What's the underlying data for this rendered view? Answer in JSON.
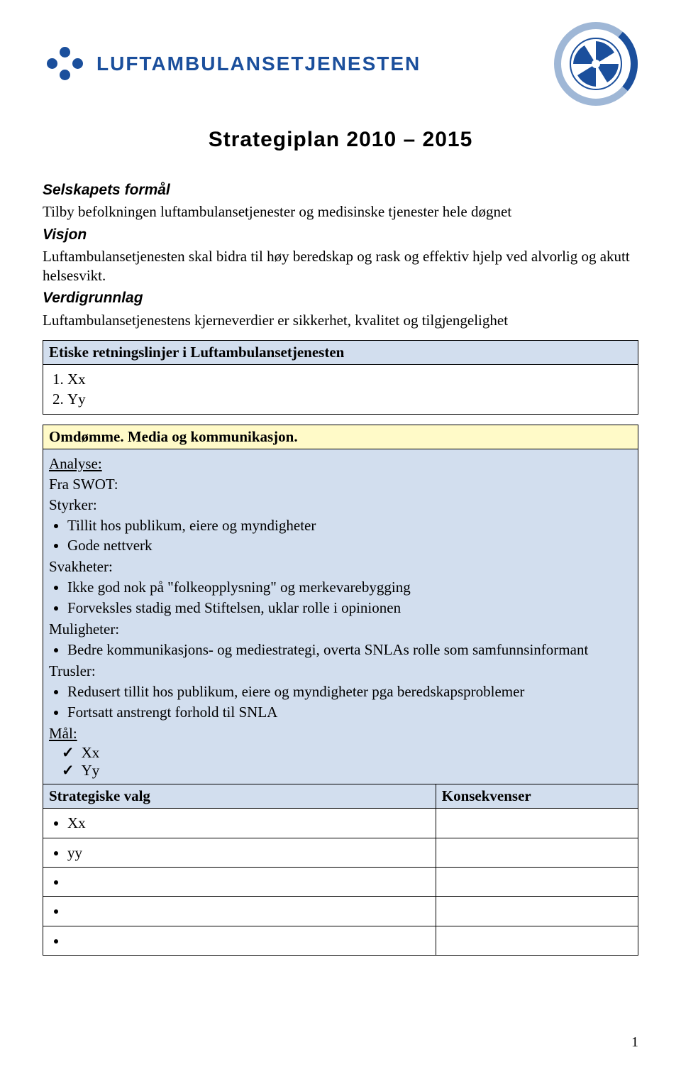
{
  "brand": {
    "name": "LUFTAMBULANSETJENESTEN"
  },
  "title": "Strategiplan 2010 – 2015",
  "intro": {
    "formal_label": "Selskapets formål",
    "formal_text": "Tilby befolkningen luftambulansetjenester og medisinske tjenester hele døgnet",
    "visjon_label": "Visjon",
    "visjon_text": "Luftambulansetjenesten skal bidra til høy beredskap og rask og effektiv hjelp ved alvorlig og akutt helsesvikt.",
    "verdigrunnlag_label": "Verdigrunnlag",
    "verdigrunnlag_text": "Luftambulansetjenestens kjerneverdier er sikkerhet, kvalitet og tilgjengelighet"
  },
  "etiske": {
    "header": "Etiske retningslinjer i Luftambulansetjenesten",
    "items": [
      "Xx",
      "Yy"
    ]
  },
  "omdomme": {
    "header": "Omdømme. Media og kommunikasjon.",
    "analyse_label": "Analyse:",
    "swot_label": "Fra SWOT:",
    "styrker_label": "Styrker:",
    "styrker": [
      "Tillit hos publikum, eiere og myndigheter",
      "Gode nettverk"
    ],
    "svakheter_label": "Svakheter:",
    "svakheter": [
      "Ikke god nok på \"folkeopplysning\" og merkevarebygging",
      "Forveksles stadig med Stiftelsen, uklar rolle i opinionen"
    ],
    "muligheter_label": "Muligheter:",
    "muligheter": [
      "Bedre kommunikasjons- og mediestrategi, overta SNLAs rolle som samfunnsinformant"
    ],
    "trusler_label": "Trusler:",
    "trusler": [
      "Redusert tillit hos publikum, eiere og myndigheter pga beredskapsproblemer",
      "Fortsatt anstrengt forhold til SNLA"
    ],
    "mal_label": "Mål:",
    "mal": [
      "Xx",
      "Yy"
    ],
    "strategiske_header": "Strategiske valg",
    "konsekvenser_header": "Konsekvenser",
    "strategiske": [
      "Xx",
      "yy"
    ]
  },
  "page_number": "1"
}
